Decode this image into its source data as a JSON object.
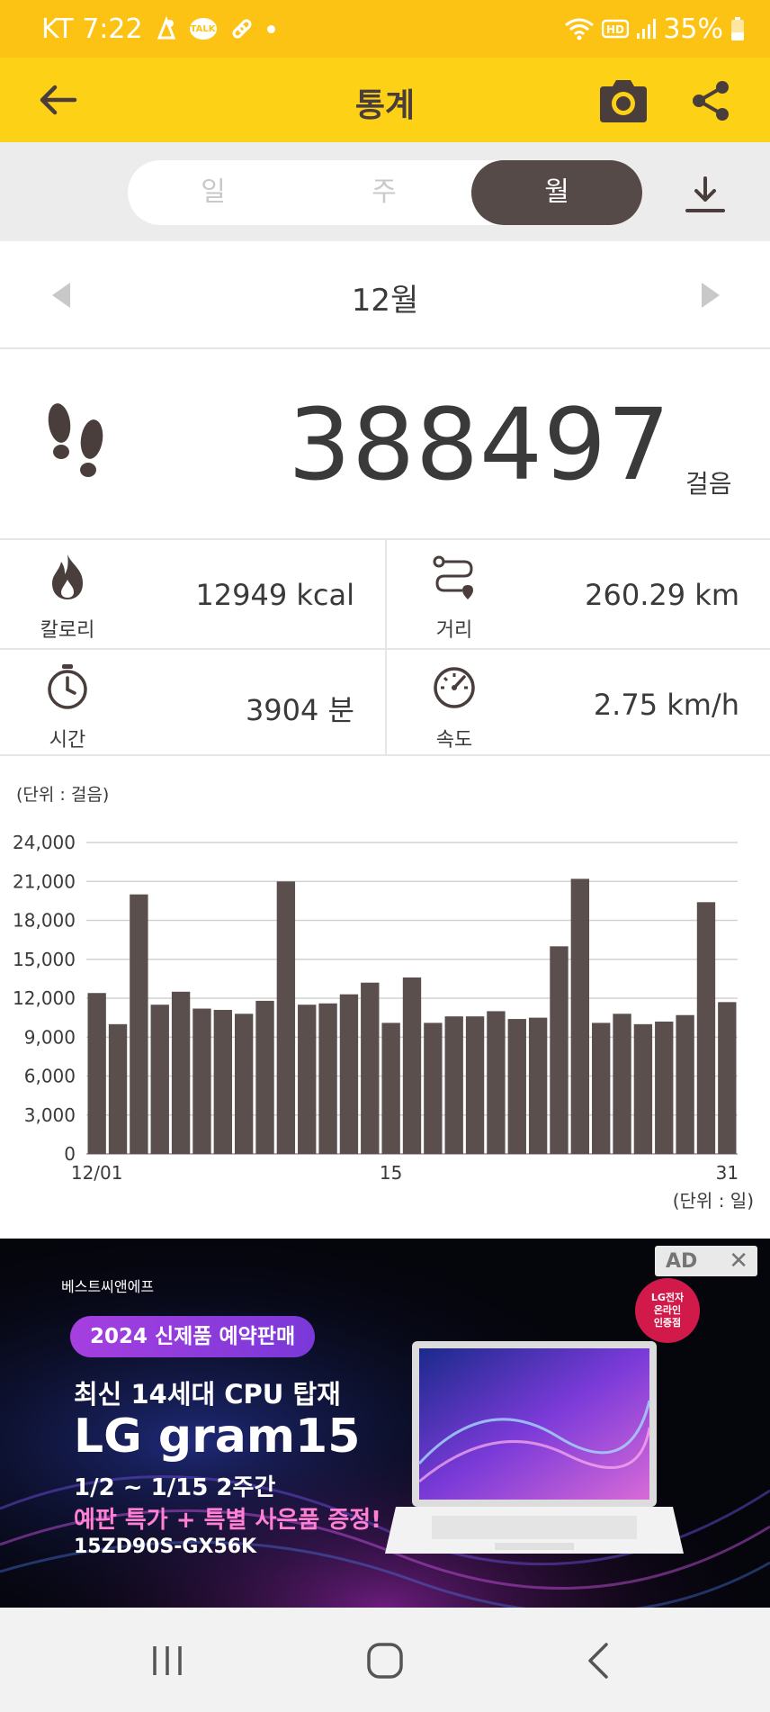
{
  "status_bar": {
    "carrier_time": "KT 7:22",
    "battery": "35%",
    "icons": [
      "notification-icon",
      "kakaotalk-icon",
      "link-icon",
      "dot-icon",
      "wifi-icon",
      "hd-icon",
      "signal-icon",
      "battery-icon"
    ],
    "talk_label": "TALK"
  },
  "app_bar": {
    "title": "통계",
    "back_icon": "arrow-left-icon",
    "camera_icon": "camera-icon",
    "share_icon": "share-icon",
    "background": "#fcd116"
  },
  "period_tabs": {
    "items": [
      {
        "label": "일",
        "active": false
      },
      {
        "label": "주",
        "active": false
      },
      {
        "label": "월",
        "active": true
      }
    ],
    "download_icon": "download-icon"
  },
  "month_nav": {
    "label": "12월",
    "prev_icon": "triangle-left-icon",
    "next_icon": "triangle-right-icon"
  },
  "steps": {
    "value": "388497",
    "unit": "걸음",
    "icon": "footprints-icon"
  },
  "stats": {
    "calories": {
      "label": "칼로리",
      "value": "12949 kcal",
      "icon": "flame-icon"
    },
    "distance": {
      "label": "거리",
      "value": "260.29 km",
      "icon": "route-icon"
    },
    "time": {
      "label": "시간",
      "value": "3904 분",
      "icon": "stopwatch-icon"
    },
    "speed": {
      "label": "속도",
      "value": "2.75 km/h",
      "icon": "speedometer-icon"
    }
  },
  "chart_data": {
    "type": "bar",
    "y_unit_label": "(단위 : 걸음)",
    "x_unit_label": "(단위 : 일)",
    "y_ticks": [
      "0",
      "3,000",
      "6,000",
      "9,000",
      "12,000",
      "15,000",
      "18,000",
      "21,000",
      "24,000"
    ],
    "ylim": [
      0,
      24000
    ],
    "x_tick_labels": [
      {
        "day": 1,
        "label": "12/01"
      },
      {
        "day": 15,
        "label": "15"
      },
      {
        "day": 31,
        "label": "31"
      }
    ],
    "grid": true,
    "bar_color": "#5a4f4d",
    "values": [
      12400,
      10000,
      20000,
      11500,
      12500,
      11200,
      11100,
      10800,
      11800,
      21000,
      11500,
      11600,
      12300,
      13200,
      10100,
      13600,
      10100,
      10600,
      10600,
      11000,
      10400,
      10500,
      16000,
      21200,
      10100,
      10800,
      10000,
      10200,
      10700,
      19400,
      11700
    ]
  },
  "ad": {
    "badge": "AD",
    "close": "✕",
    "brand": "베스트씨앤에프",
    "pill": "2024 신제품 예약판매",
    "line1": "최신 14세대 CPU 탑재",
    "line2": "LG gram15",
    "line3": "1/2 ~ 1/15 2주간",
    "line4": "예판 특가 + 특별 사은품 증정!",
    "line5": "15ZD90S-GX56K",
    "seal": [
      "LG전자",
      "온라인",
      "인증점"
    ]
  },
  "nav_bar": {
    "items": [
      "recent-apps-icon",
      "home-icon",
      "back-icon"
    ]
  }
}
